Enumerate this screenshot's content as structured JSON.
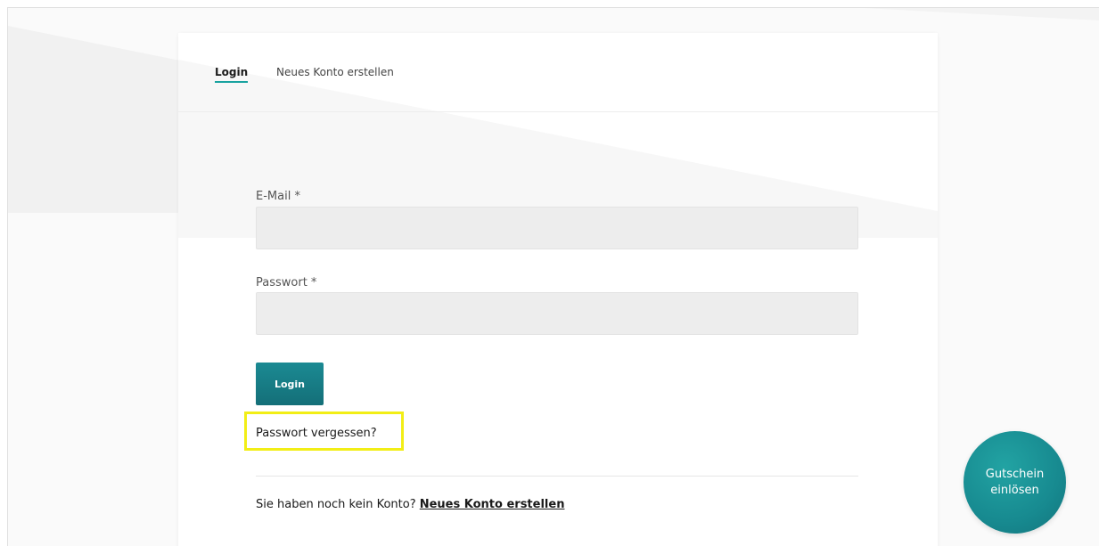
{
  "tabs": {
    "login": "Login",
    "register": "Neues Konto erstellen"
  },
  "form": {
    "email_label": "E-Mail *",
    "email_value": "",
    "password_label": "Passwort *",
    "password_value": "",
    "login_button": "Login",
    "forgot_password": "Passwort vergessen?",
    "no_account_text": "Sie haben noch kein Konto? ",
    "create_account_link": "Neues Konto erstellen"
  },
  "voucher": {
    "line1": "Gutschein",
    "line2": "einlösen"
  },
  "colors": {
    "accent": "#1aa3a0",
    "button": "#178a93",
    "highlight": "#f2ee16"
  }
}
